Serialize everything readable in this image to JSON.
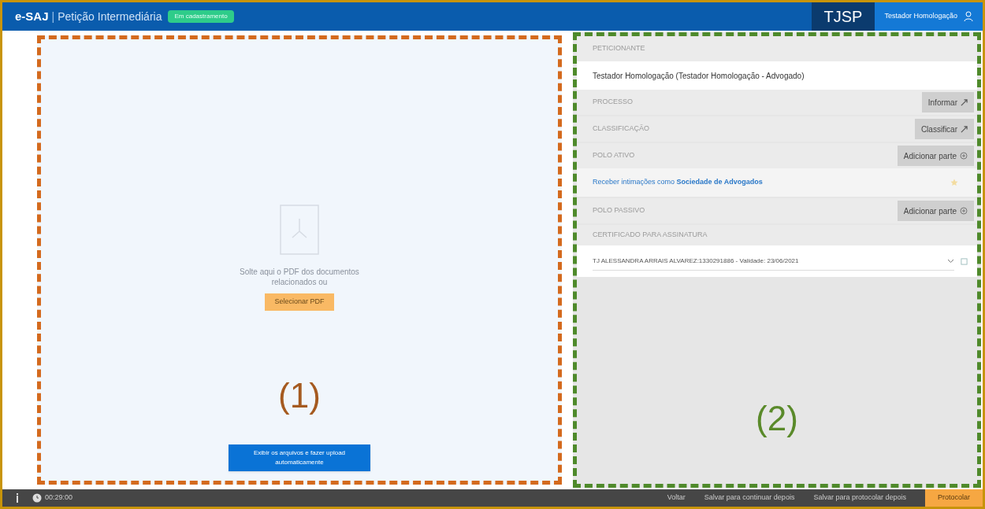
{
  "header": {
    "logo": "e-SAJ",
    "separator": "|",
    "title": "Petição Intermediária",
    "badge": "Em cadastramento",
    "court": "TJSP",
    "user": "Testador Homologação"
  },
  "upload": {
    "hint": "Solte aqui o PDF dos documentos relacionados ou",
    "select_button": "Selecionar PDF",
    "annotation": "(1)",
    "auto_button": "Exibir os arquivos e fazer upload automaticamente"
  },
  "form": {
    "annotation": "(2)",
    "sections": [
      {
        "kind": "value",
        "label": "PETICIONANTE",
        "value": "Testador Homologação (Testador Homologação - Advogado)"
      },
      {
        "kind": "action",
        "label": "PROCESSO",
        "button": "Informar"
      },
      {
        "kind": "action",
        "label": "CLASSIFICAÇÃO",
        "button": "Classificar"
      },
      {
        "kind": "parties",
        "label": "POLO ATIVO",
        "button": "Adicionar parte",
        "link": "Receber intimações como **Sociedade de Advogados**"
      },
      {
        "kind": "parties",
        "label": "POLO PASSIVO",
        "button": "Adicionar parte"
      },
      {
        "kind": "certificate",
        "label": "CERTIFICADO PARA ASSINATURA",
        "value": "TJ ALESSANDRA ARRAIS ALVAREZ:1330291886 - Validade: 23/06/2021"
      }
    ]
  },
  "footer": {
    "timer": "00:29:00",
    "buttons": [
      {
        "label": "Voltar",
        "primary": false
      },
      {
        "label": "Salvar para continuar depois",
        "primary": false
      },
      {
        "label": "Salvar para protocolar depois",
        "primary": false
      },
      {
        "label": "Protocolar",
        "primary": true
      }
    ]
  }
}
